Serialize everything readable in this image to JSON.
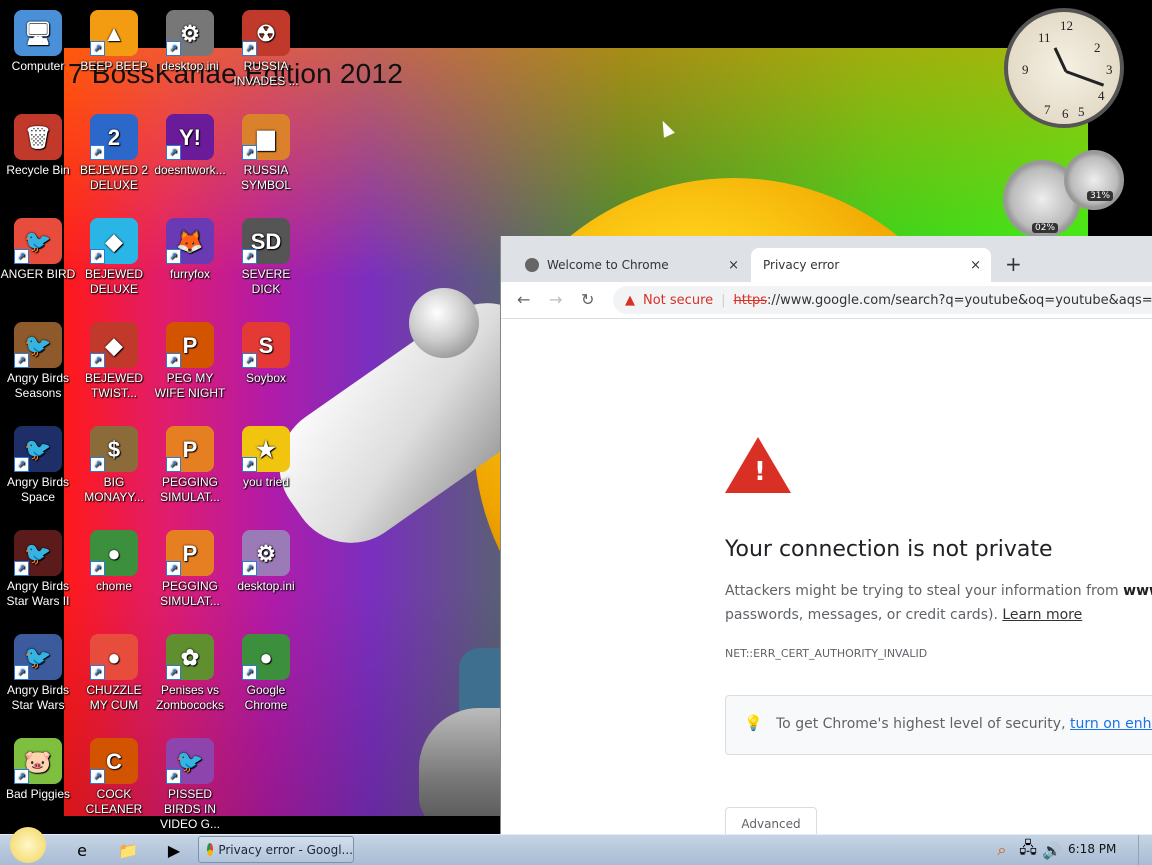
{
  "wallpaper": {
    "title": "7 BossKarlae Edition 2012"
  },
  "desktop_icons": [
    {
      "label": "Computer",
      "glyph": "🖥",
      "color": "#4a90d9"
    },
    {
      "label": "Recycle Bin",
      "glyph": "🗑",
      "color": "#c0392b"
    },
    {
      "label": "ANGER BIRD",
      "glyph": "🐦",
      "color": "#e74c3c"
    },
    {
      "label": "Angry Birds Seasons",
      "glyph": "🐦",
      "color": "#8e5a2b"
    },
    {
      "label": "Angry Birds Space",
      "glyph": "🐦",
      "color": "#1d2f66"
    },
    {
      "label": "Angry Birds Star Wars II",
      "glyph": "🐦",
      "color": "#5b1b1b"
    },
    {
      "label": "Angry Birds Star Wars",
      "glyph": "🐦",
      "color": "#3b5b9c"
    },
    {
      "label": "Bad Piggies",
      "glyph": "🐷",
      "color": "#7fbf3f"
    },
    {
      "label": "BEEP BEEP",
      "glyph": "▲",
      "color": "#f39c12"
    },
    {
      "label": "BEJEWED 2 DELUXE",
      "glyph": "2",
      "color": "#2c68c9"
    },
    {
      "label": "BEJEWED DELUXE",
      "glyph": "◆",
      "color": "#29b6e6"
    },
    {
      "label": "BEJEWED TWIST...",
      "glyph": "◆",
      "color": "#c0392b"
    },
    {
      "label": "BIG MONAYY...",
      "glyph": "$",
      "color": "#8b6b3a"
    },
    {
      "label": "chome",
      "glyph": "●",
      "color": "#3c8f3c"
    },
    {
      "label": "CHUZZLE MY CUM",
      "glyph": "●",
      "color": "#e74c3c"
    },
    {
      "label": "COCK CLEANER",
      "glyph": "C",
      "color": "#d35400"
    },
    {
      "label": "desktop.ini",
      "glyph": "⚙",
      "color": "#777"
    },
    {
      "label": "doesntwork...",
      "glyph": "Y!",
      "color": "#6a1b9a"
    },
    {
      "label": "furryfox",
      "glyph": "🦊",
      "color": "#6a3ab5"
    },
    {
      "label": "PEG MY WIFE NIGHT",
      "glyph": "P",
      "color": "#d35400"
    },
    {
      "label": "PEGGING SIMULAT...",
      "glyph": "P",
      "color": "#e67e22"
    },
    {
      "label": "PEGGING SIMULAT...",
      "glyph": "P",
      "color": "#e67e22"
    },
    {
      "label": "Penises vs Zombococks",
      "glyph": "✿",
      "color": "#5f8f2f"
    },
    {
      "label": "PISSED BIRDS IN VIDEO G...",
      "glyph": "🐦",
      "color": "#8e44ad"
    },
    {
      "label": "RUSSIA INVADES ...",
      "glyph": "☢",
      "color": "#c0392b"
    },
    {
      "label": "RUSSIA SYMBOL",
      "glyph": "▆",
      "color": "#d9822b"
    },
    {
      "label": "SEVERE DICK",
      "glyph": "SD",
      "color": "#555"
    },
    {
      "label": "Soybox",
      "glyph": "S",
      "color": "#e53935"
    },
    {
      "label": "you tried",
      "glyph": "★",
      "color": "#f1c40f"
    },
    {
      "label": "desktop.ini",
      "glyph": "⚙",
      "color": "#9b7ab8"
    },
    {
      "label": "Google Chrome",
      "glyph": "●",
      "color": "#3c8f3c"
    }
  ],
  "gadgets": {
    "cpu": "02%",
    "memory": "31%"
  },
  "browser": {
    "tabs": [
      {
        "label": "Welcome to Chrome"
      },
      {
        "label": "Privacy error"
      }
    ],
    "new_tab": "+",
    "close": "×",
    "not_secure": "Not secure",
    "url_scheme": "https",
    "url_rest": "://www.google.com/search?q=youtube&oq=youtube&aqs=chr",
    "error_title": "Your connection is not private",
    "error_line1_start": "Attackers might be trying to steal your information from ",
    "error_line1_domain": "www.go",
    "error_line2": "passwords, messages, or credit cards). ",
    "learn_more": "Learn more",
    "error_code": "NET::ERR_CERT_AUTHORITY_INVALID",
    "security_text": "To get Chrome's highest level of security, ",
    "security_link": "turn on enhanc",
    "advanced": "Advanced"
  },
  "taskbar": {
    "task_label": "Privacy error - Googl...",
    "time": "6:18 PM"
  }
}
